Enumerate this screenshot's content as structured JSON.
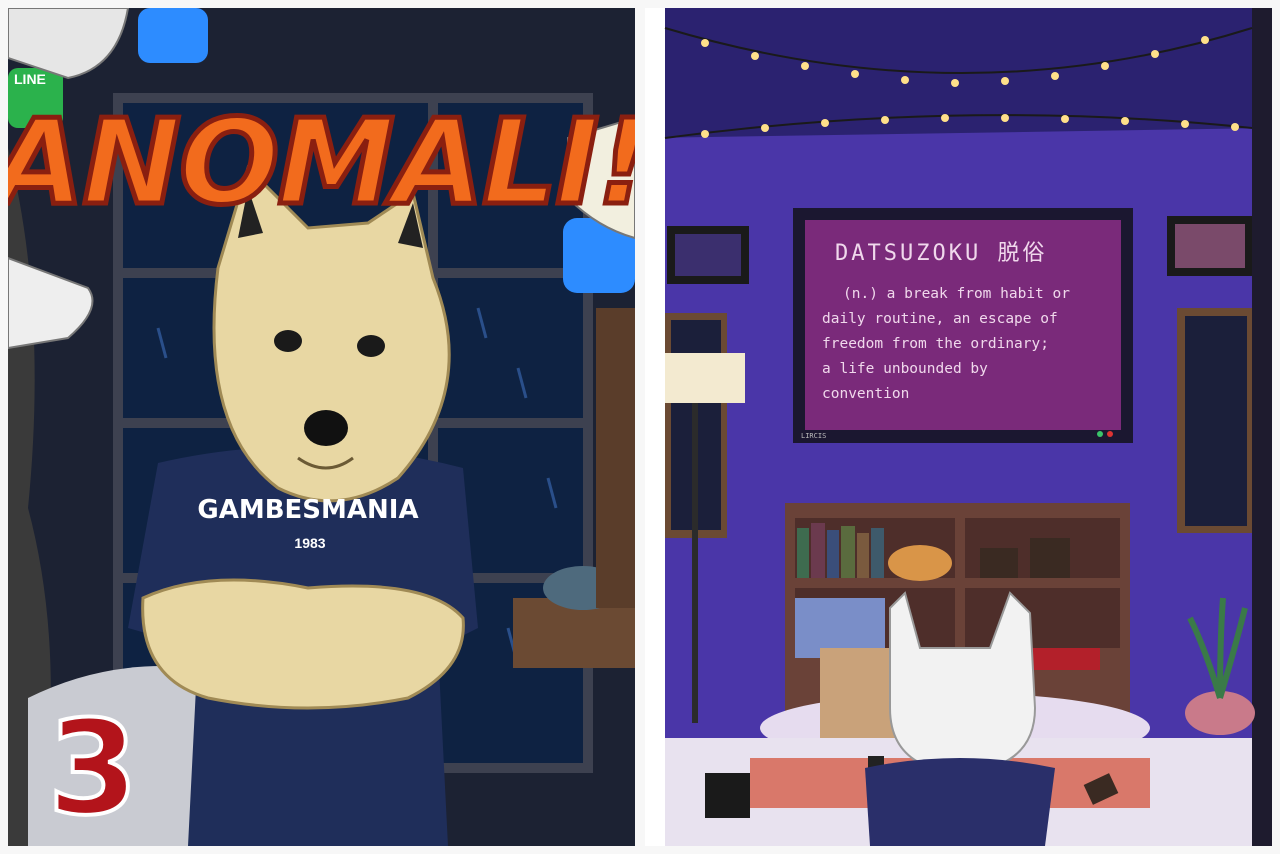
{
  "left_panel": {
    "title": "ANOMALI!",
    "issue_number": "3",
    "shirt_brand": "GAMBESMANIA",
    "shirt_year": "1983",
    "app_badge": "LINE",
    "colors": {
      "title_fill": "#f26b1d",
      "title_outline": "#8a1f10",
      "number_fill": "#b3141b",
      "shirt": "#1f2e5a",
      "mask": "#e8d7a3",
      "window": "#0e2242"
    }
  },
  "right_panel": {
    "screen_title": "DATSUZOKU 脱俗",
    "definition_lines": [
      "(n.) a break from habit or",
      "daily routine, an escape of",
      "freedom from the ordinary;",
      "a life unbounded by",
      "convention"
    ],
    "screen_footer": "LIRCIS",
    "colors": {
      "wall": "#4a36a8",
      "ceiling": "#2b2270",
      "screen": "#7a2a7a",
      "screen_text": "#f0d8ec",
      "shelf": "#6a4238"
    }
  }
}
